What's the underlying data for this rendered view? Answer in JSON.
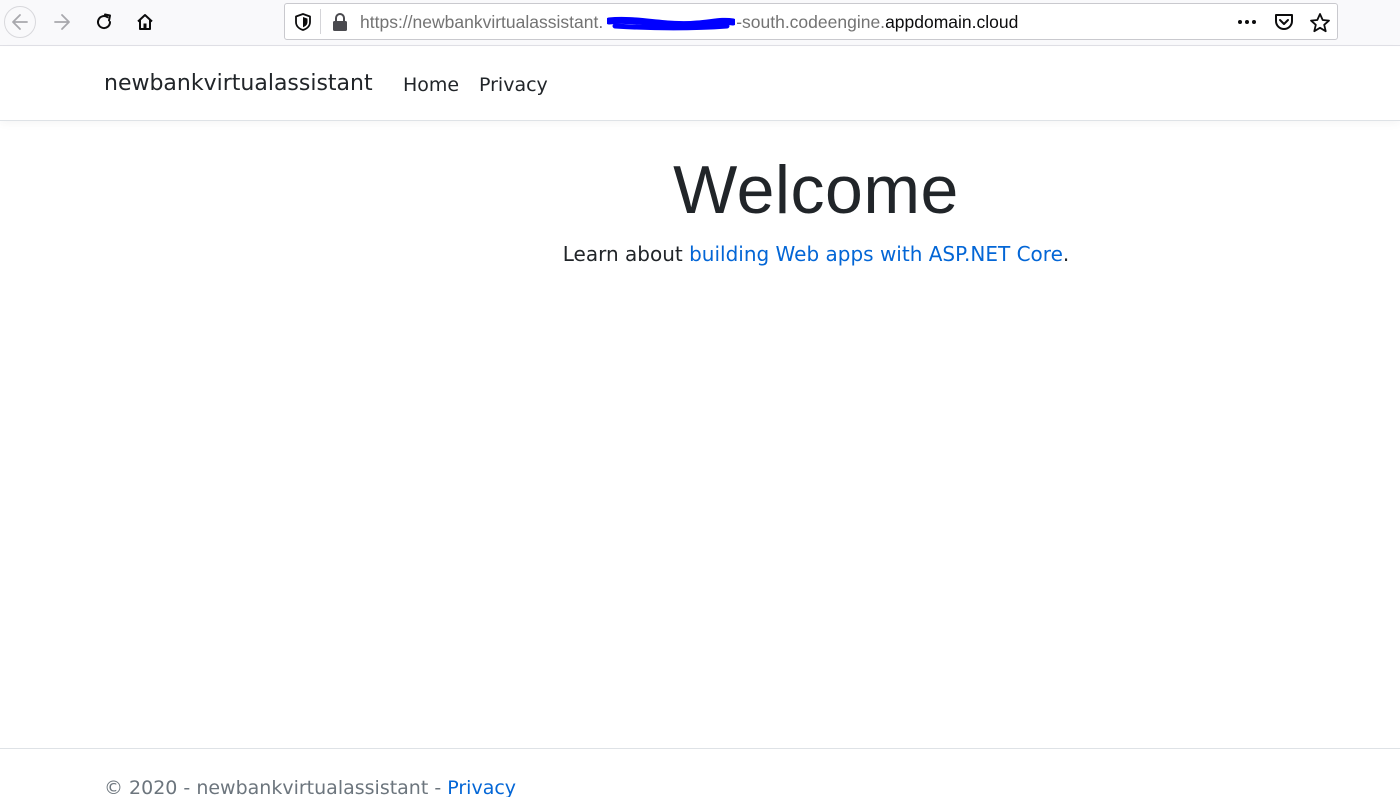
{
  "browser": {
    "url_prefix": "https://newbankvirtualassistant.",
    "url_mid": "-south.codeengine.",
    "url_domain": "appdomain.cloud",
    "icons": [
      "back-arrow-icon",
      "forward-arrow-icon",
      "reload-icon",
      "home-icon",
      "shield-icon",
      "lock-icon",
      "more-icon",
      "pocket-icon",
      "star-icon"
    ],
    "redaction_color": "#0000ff"
  },
  "navbar": {
    "brand": "newbankvirtualassistant",
    "links": [
      {
        "label": "Home"
      },
      {
        "label": "Privacy"
      }
    ]
  },
  "main": {
    "heading": "Welcome",
    "learn_prefix": "Learn about ",
    "learn_link": "building Web apps with ASP.NET Core",
    "learn_suffix": "."
  },
  "footer": {
    "copyright": "© 2020 - newbankvirtualassistant - ",
    "privacy_link": "Privacy"
  },
  "colors": {
    "link": "#0366d6",
    "text": "#212529",
    "muted": "#6c757d"
  }
}
